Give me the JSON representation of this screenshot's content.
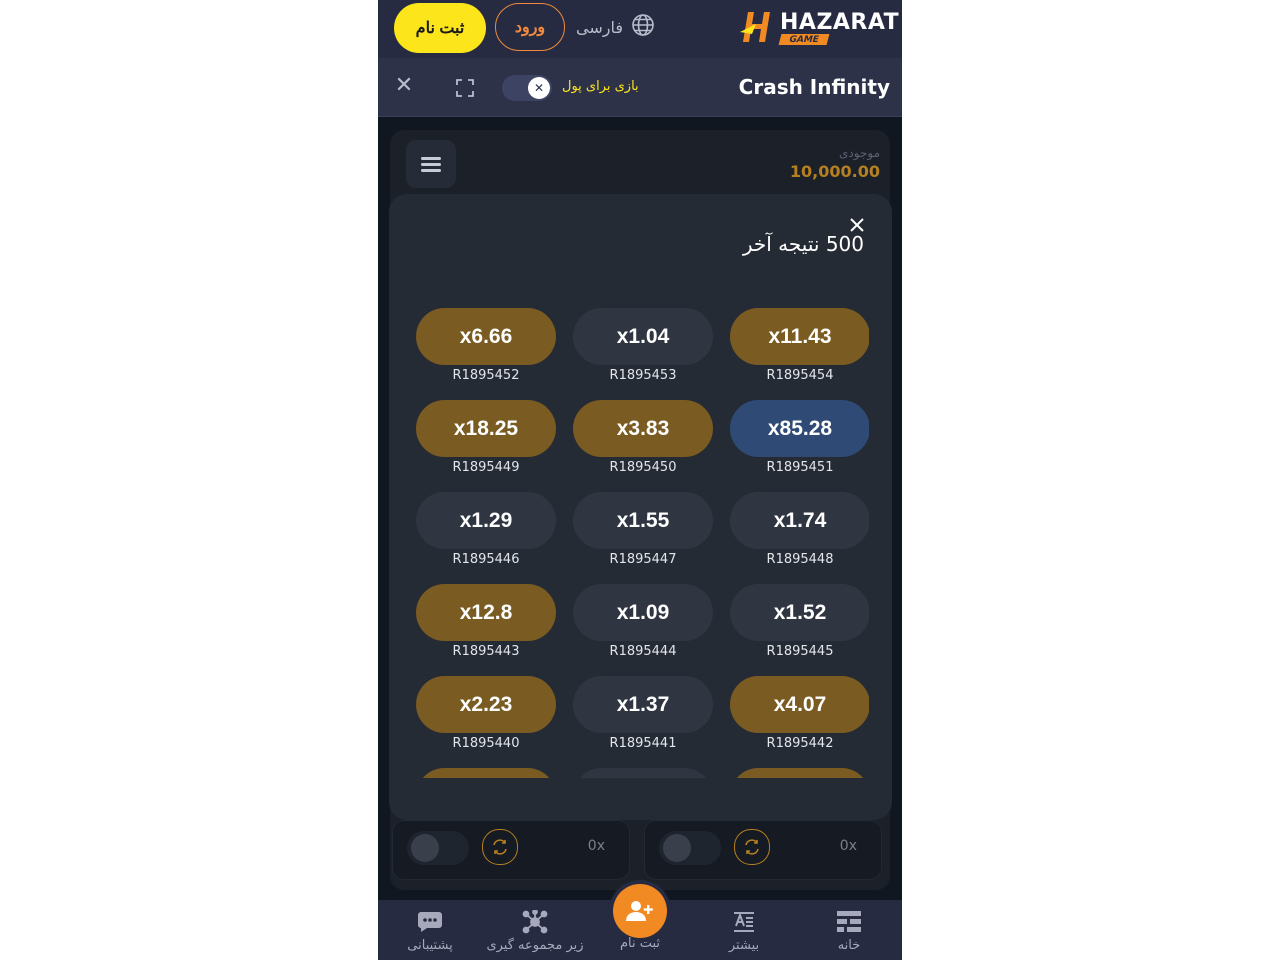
{
  "header": {
    "register_label": "ثبت نام",
    "login_label": "ورود",
    "language_label": "فارسی",
    "logo_text": "HAZARAT",
    "logo_subtext": "GAME"
  },
  "game_bar": {
    "title": "Crash Infinity",
    "real_money_label": "بازی برای پول",
    "toggle_symbol": "✕",
    "close_symbol": "✕"
  },
  "balance": {
    "label": "موجودی",
    "value": "10,000.00"
  },
  "results_modal": {
    "title": "500 نتیجه آخر",
    "results": [
      {
        "multiplier": "x6.66",
        "round": "R1895452",
        "color": "gold"
      },
      {
        "multiplier": "x1.04",
        "round": "R1895453",
        "color": "gray"
      },
      {
        "multiplier": "x11.43",
        "round": "R1895454",
        "color": "gold"
      },
      {
        "multiplier": "x18.25",
        "round": "R1895449",
        "color": "gold"
      },
      {
        "multiplier": "x3.83",
        "round": "R1895450",
        "color": "gold"
      },
      {
        "multiplier": "x85.28",
        "round": "R1895451",
        "color": "blue"
      },
      {
        "multiplier": "x1.29",
        "round": "R1895446",
        "color": "gray"
      },
      {
        "multiplier": "x1.55",
        "round": "R1895447",
        "color": "gray"
      },
      {
        "multiplier": "x1.74",
        "round": "R1895448",
        "color": "gray"
      },
      {
        "multiplier": "x12.8",
        "round": "R1895443",
        "color": "gold"
      },
      {
        "multiplier": "x1.09",
        "round": "R1895444",
        "color": "gray"
      },
      {
        "multiplier": "x1.52",
        "round": "R1895445",
        "color": "gray"
      },
      {
        "multiplier": "x2.23",
        "round": "R1895440",
        "color": "gold"
      },
      {
        "multiplier": "x1.37",
        "round": "R1895441",
        "color": "gray"
      },
      {
        "multiplier": "x4.07",
        "round": "R1895442",
        "color": "gold"
      },
      {
        "multiplier": "",
        "round": "",
        "color": "gold"
      },
      {
        "multiplier": "",
        "round": "",
        "color": "gray"
      },
      {
        "multiplier": "",
        "round": "",
        "color": "gold"
      }
    ]
  },
  "bet_panels": [
    {
      "multiplier": "0x"
    },
    {
      "multiplier": "0x"
    }
  ],
  "bottom_nav": {
    "support": "پشتیبانی",
    "referral": "زیر مجموعه گیری",
    "register": "ثبت نام",
    "more": "بیشتر",
    "home": "خانه"
  },
  "colors": {
    "accent_yellow": "#fde51b",
    "accent_orange": "#f28a24",
    "gold_pill": "#7a5b21",
    "blue_pill": "#2f4b75",
    "gray_pill": "#303641"
  }
}
